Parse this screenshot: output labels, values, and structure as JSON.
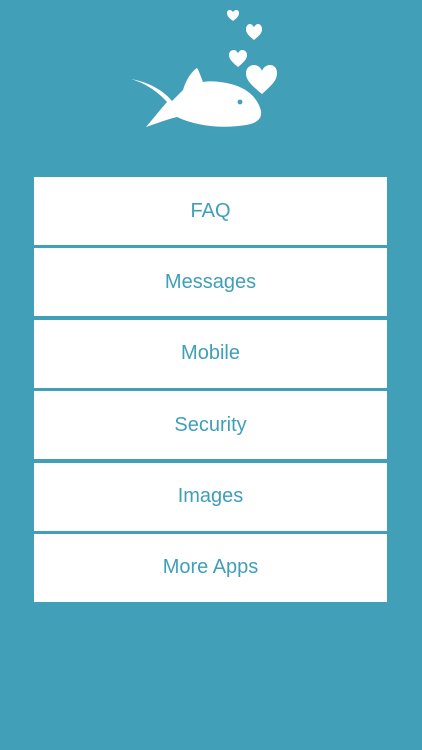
{
  "colors": {
    "background": "#429fb8",
    "item_background": "#ffffff",
    "item_text": "#3f9fb8",
    "logo": "#ffffff"
  },
  "logo": {
    "icon": "fish-with-hearts-icon"
  },
  "menu": {
    "items": [
      {
        "label": "FAQ"
      },
      {
        "label": "Messages"
      },
      {
        "label": "Mobile"
      },
      {
        "label": "Security"
      },
      {
        "label": "Images"
      },
      {
        "label": "More Apps"
      }
    ]
  }
}
